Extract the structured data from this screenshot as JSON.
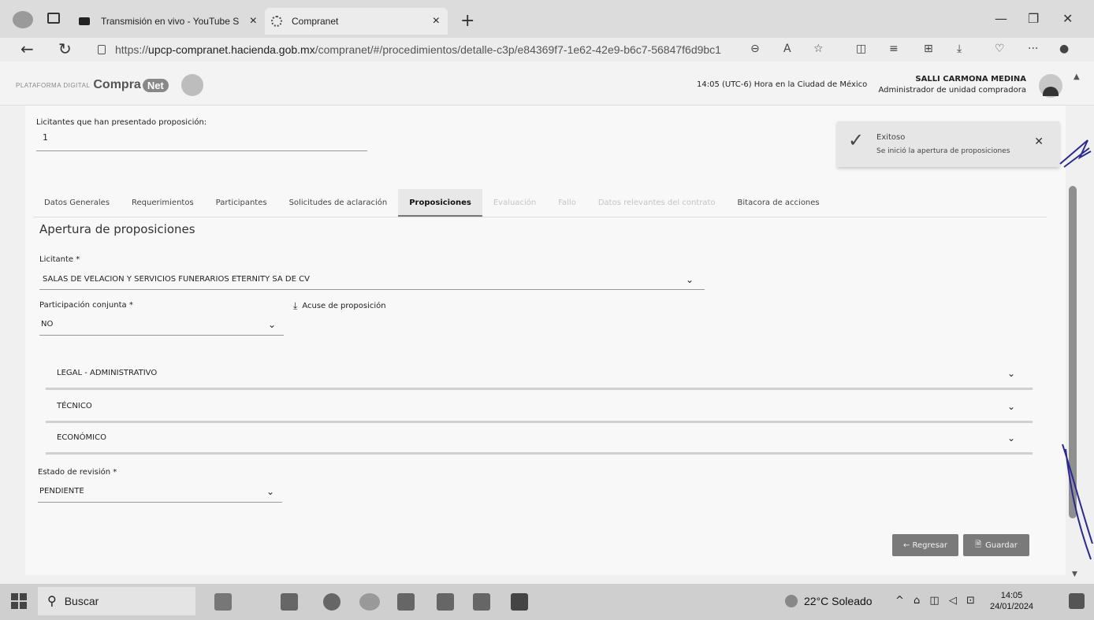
{
  "browser": {
    "tabs": [
      {
        "title": "Transmisión en vivo - YouTube S",
        "active": false
      },
      {
        "title": "Compranet",
        "active": true
      }
    ],
    "url_prefix": "https://",
    "url_host": "upcp-compranet.hacienda.gob.mx",
    "url_path": "/compranet/#/procedimientos/detalle-c3p/e84369f7-1e62-42e9-b6c7-56847f6d9bc1"
  },
  "header": {
    "logo_small": "PLATAFORMA DIGITAL",
    "logo_text": "Compra",
    "logo_badge": "Net",
    "time_info": "14:05 (UTC-6) Hora en la Ciudad de México",
    "user_name": "SALLI CARMONA MEDINA",
    "user_role": "Administrador de unidad compradora"
  },
  "summary": {
    "licitantes_label": "Licitantes que han presentado proposición:",
    "licitantes_count": "1"
  },
  "toast": {
    "title": "Exitoso",
    "message": "Se inició la apertura de proposiciones"
  },
  "tabs": [
    {
      "label": "Datos Generales",
      "state": "normal"
    },
    {
      "label": "Requerimientos",
      "state": "normal"
    },
    {
      "label": "Participantes",
      "state": "normal"
    },
    {
      "label": "Solicitudes de aclaración",
      "state": "normal"
    },
    {
      "label": "Proposiciones",
      "state": "active"
    },
    {
      "label": "Evaluación",
      "state": "disabled"
    },
    {
      "label": "Fallo",
      "state": "disabled"
    },
    {
      "label": "Datos relevantes del contrato",
      "state": "disabled"
    },
    {
      "label": "Bitacora de acciones",
      "state": "normal"
    }
  ],
  "form": {
    "title": "Apertura de proposiciones",
    "licitante_label": "Licitante *",
    "licitante_value": "SALAS DE VELACION Y SERVICIOS FUNERARIOS ETERNITY SA DE CV",
    "participacion_label": "Participación conjunta *",
    "participacion_value": "NO",
    "acuse_label": "Acuse de proposición",
    "sections": [
      "LEGAL - ADMINISTRATIVO",
      "TÉCNICO",
      "ECONÓMICO"
    ],
    "estado_label": "Estado de revisión *",
    "estado_value": "PENDIENTE",
    "back_label": "← Regresar",
    "save_label": "Guardar"
  },
  "taskbar": {
    "search_label": "Buscar",
    "weather": "22°C Soleado",
    "time": "14:05",
    "date": "24/01/2024"
  }
}
